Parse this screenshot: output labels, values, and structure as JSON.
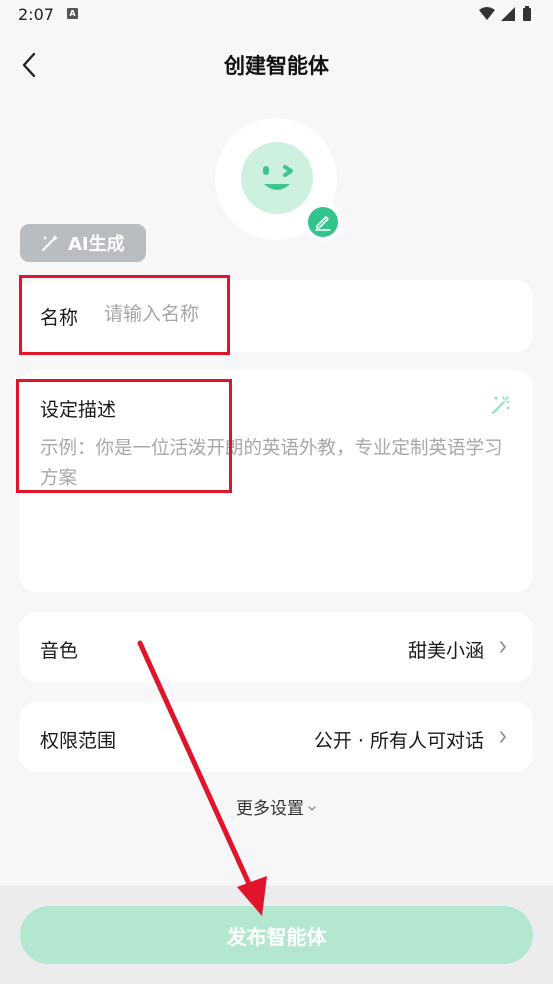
{
  "status_bar": {
    "time": "2:07",
    "notification_badge": "A"
  },
  "header": {
    "title": "创建智能体"
  },
  "avatar": {
    "edit_icon": "pencil-icon",
    "face_color": "#cdf0df",
    "accent": "#34c48b"
  },
  "ai_generate": {
    "label": "AI生成",
    "icon": "magic-wand-icon"
  },
  "name_field": {
    "label": "名称",
    "placeholder": "请输入名称",
    "value": ""
  },
  "description_field": {
    "label": "设定描述",
    "placeholder": "示例：你是一位活泼开朗的英语外教，专业定制英语学习方案",
    "value": "",
    "icon": "magic-wand-icon"
  },
  "voice": {
    "label": "音色",
    "value": "甜美小涵"
  },
  "permission": {
    "label": "权限范围",
    "value": "公开 · 所有人可对话"
  },
  "more_settings": {
    "label": "更多设置"
  },
  "publish_button": {
    "label": "发布智能体",
    "color": "#b4e7d0"
  },
  "annotation_color": "#e0142b"
}
